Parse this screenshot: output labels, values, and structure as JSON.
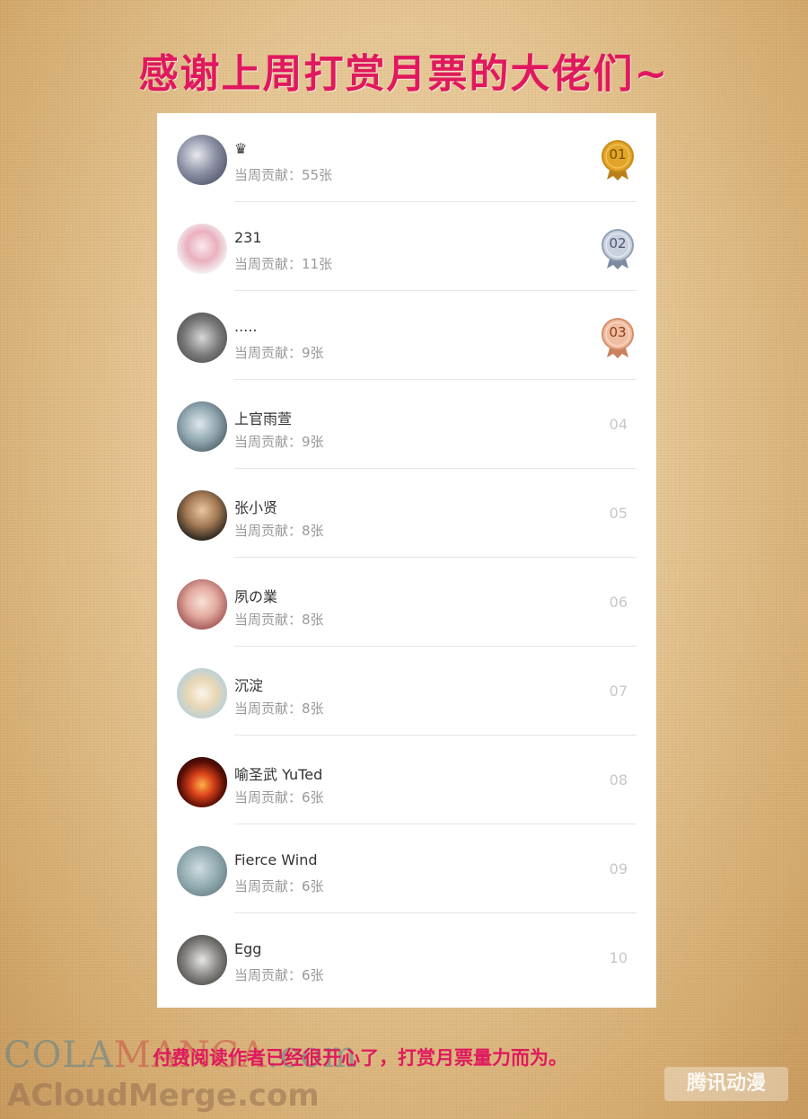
{
  "banner": {
    "title": "感谢上周打赏月票的大佬们~"
  },
  "colors": {
    "accent": "#e0195e",
    "gold": "#e2a52a",
    "silver": "#a9b4c6",
    "bronze": "#e7a58a"
  },
  "leaderboard": [
    {
      "rank": "01",
      "name": "♛",
      "contribution": "当周贡献：55张",
      "medal": "gold"
    },
    {
      "rank": "02",
      "name": "231",
      "contribution": "当周贡献：11张",
      "medal": "silver"
    },
    {
      "rank": "03",
      "name": ".....",
      "contribution": "当周贡献：9张",
      "medal": "bronze"
    },
    {
      "rank": "04",
      "name": "上官雨萱",
      "contribution": "当周贡献：9张"
    },
    {
      "rank": "05",
      "name": "张小贤",
      "contribution": "当周贡献：8张"
    },
    {
      "rank": "06",
      "name": "夙の業",
      "contribution": "当周贡献：8张"
    },
    {
      "rank": "07",
      "name": "沉淀",
      "contribution": "当周贡献：8张"
    },
    {
      "rank": "08",
      "name": "喻圣武 YuTed",
      "contribution": "当周贡献：6张"
    },
    {
      "rank": "09",
      "name": "Fierce Wind",
      "contribution": "当周贡献：6张"
    },
    {
      "rank": "10",
      "name": "Egg",
      "contribution": "当周贡献：6张"
    }
  ],
  "footer": {
    "text": "付费阅读作者已经很开心了，打赏月票量力而为。"
  },
  "watermarks": {
    "colamanga": "COLAMANGA.com",
    "colamanga_part1": "COLA",
    "colamanga_part2": "MANGA",
    "colamanga_part3": ".com",
    "acloudmerge": "ACloudMerge.com",
    "platform": "腾讯动漫"
  }
}
